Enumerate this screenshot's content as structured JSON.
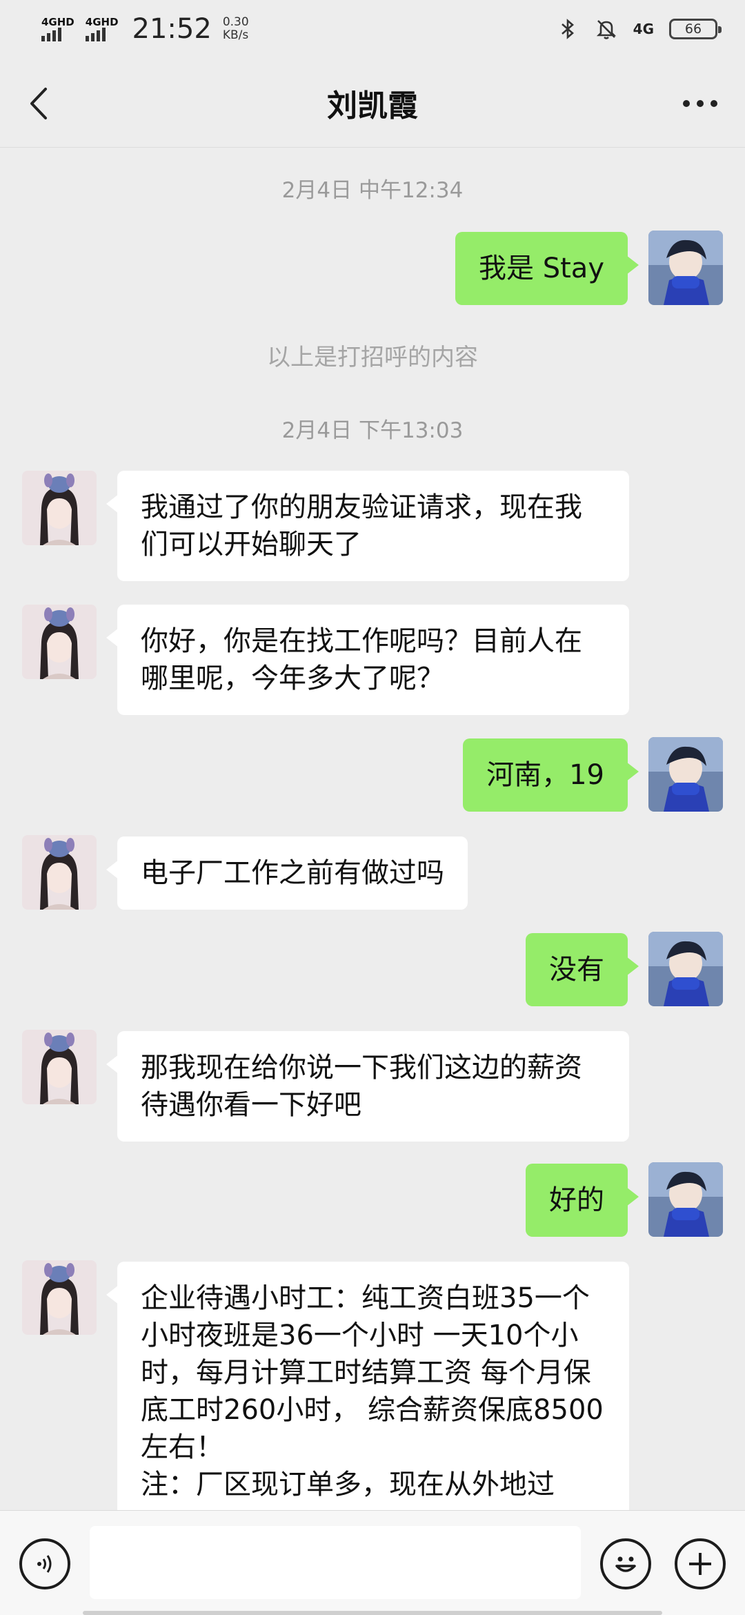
{
  "status_bar": {
    "signal1": "4GHD",
    "signal2": "4GHD",
    "time": "21:52",
    "speed_value": "0.30",
    "speed_unit": "KB/s",
    "network": "4G",
    "battery": "66"
  },
  "header": {
    "title": "刘凯霞"
  },
  "chat": {
    "timestamps": [
      "2月4日 中午12:34",
      "2月4日 下午13:03"
    ],
    "system_note": "以上是打招呼的内容",
    "messages": [
      {
        "side": "out",
        "text": "我是 Stay"
      },
      {
        "side": "in",
        "text": "我通过了你的朋友验证请求，现在我们可以开始聊天了"
      },
      {
        "side": "in",
        "text": "你好，你是在找工作呢吗？目前人在哪里呢，今年多大了呢？"
      },
      {
        "side": "out",
        "text": "河南，19"
      },
      {
        "side": "in",
        "text": "电子厂工作之前有做过吗"
      },
      {
        "side": "out",
        "text": "没有"
      },
      {
        "side": "in",
        "text": "那我现在给你说一下我们这边的薪资待遇你看一下好吧"
      },
      {
        "side": "out",
        "text": "好的"
      },
      {
        "side": "in",
        "text": "企业待遇小时工：纯工资白班35一个小时夜班是36一个小时 一天10个小时，每月计算工时结算工资 每个月保底工时260小时， 综合薪资保底8500左右！\n注：厂区现订单多，现在从外地过"
      }
    ]
  },
  "input": {
    "value": ""
  },
  "colors": {
    "outgoing_bubble": "#95ec69",
    "incoming_bubble": "#ffffff",
    "background": "#ededed"
  }
}
